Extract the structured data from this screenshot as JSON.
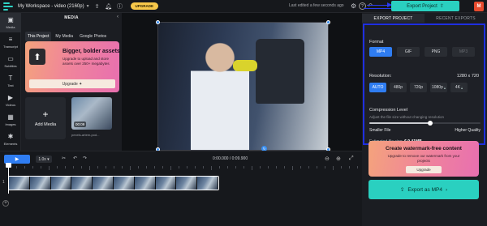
{
  "header": {
    "workspace_title": "My Workspace - video (2160p)",
    "upgrade": "UPGRADE",
    "last_edited": "Last edited a few seconds ago",
    "export_label": "Export Project",
    "avatar_initial": "M"
  },
  "rail": {
    "items": [
      {
        "label": "Media",
        "icon": "media-icon"
      },
      {
        "label": "Transcript",
        "icon": "transcript-icon"
      },
      {
        "label": "Subtitles",
        "icon": "subtitles-icon"
      },
      {
        "label": "Text",
        "icon": "text-icon"
      },
      {
        "label": "Videos",
        "icon": "videos-icon"
      },
      {
        "label": "Images",
        "icon": "images-icon"
      },
      {
        "label": "Elements",
        "icon": "elements-icon"
      }
    ]
  },
  "media": {
    "title": "MEDIA",
    "tabs": [
      "This Project",
      "My Media",
      "Google Photos"
    ],
    "promo": {
      "title": "Bigger, bolder assets",
      "text": "Upgrade to upload and store assets over 250+ megabytes",
      "button": "Upgrade"
    },
    "add_media": "Add Media",
    "clip_duration": "00:09",
    "clip_name": "pexels-artem-pod..."
  },
  "export": {
    "tabs": [
      "EXPORT PROJECT",
      "RECENT EXPORTS"
    ],
    "format_label": "Format",
    "formats": [
      "MP4",
      "GIF",
      "PNG",
      "MP3"
    ],
    "resolution_label": "Resolution:",
    "resolution_value": "1280 x 720",
    "resolutions": [
      "AUTO",
      "480p",
      "720p",
      "1080p",
      "4K"
    ],
    "compression_label": "Compression Level",
    "compression_hint": "Adjust the file size without changing resolution",
    "compression_level": 0.55,
    "smaller": "Smaller File",
    "higher": "Higher Quality",
    "estimate_label": "Estimated file size:",
    "estimate_value": "6.9 41MB",
    "watermark": {
      "title": "Create watermark-free content",
      "text": "Upgrade to remove our watermark from your projects",
      "button": "Upgrade"
    },
    "export_mp4": "Export as MP4"
  },
  "timeline": {
    "speed": "1.0x",
    "timecode": "0:00.000 / 0:09.900",
    "track_number": "1"
  },
  "colors": {
    "accent": "#2ad0c0",
    "primary_blue": "#2f7df2",
    "highlight_border": "#1f2fe0"
  }
}
